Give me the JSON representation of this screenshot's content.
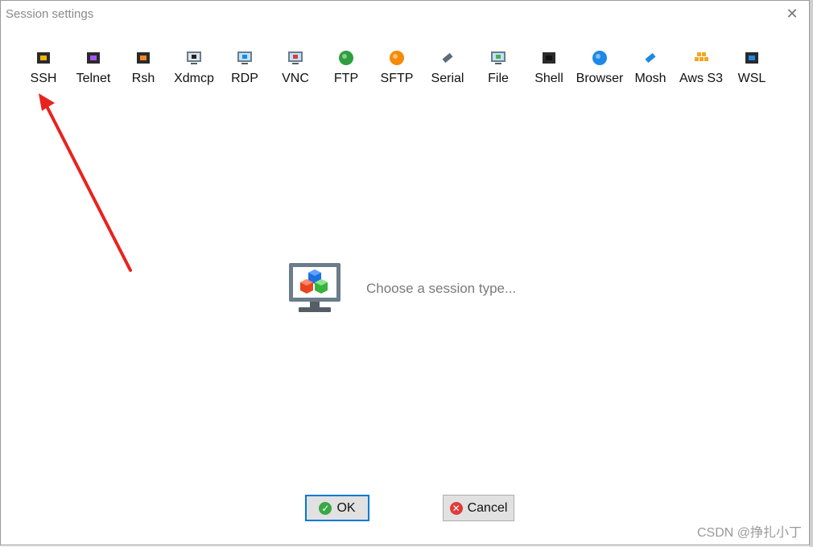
{
  "window": {
    "title": "Session settings",
    "close_glyph": "✕"
  },
  "toolbar": {
    "items": [
      {
        "label": "SSH",
        "icon": "ssh-key-icon",
        "color": "#f5b400"
      },
      {
        "label": "Telnet",
        "icon": "telnet-icon",
        "color": "#a855f7"
      },
      {
        "label": "Rsh",
        "icon": "rsh-icon",
        "color": "#f08a24"
      },
      {
        "label": "Xdmcp",
        "icon": "xdmcp-icon",
        "color": "#222222"
      },
      {
        "label": "RDP",
        "icon": "rdp-icon",
        "color": "#1e88e5"
      },
      {
        "label": "VNC",
        "icon": "vnc-icon",
        "color": "#e53935"
      },
      {
        "label": "FTP",
        "icon": "ftp-icon",
        "color": "#2e9e3e"
      },
      {
        "label": "SFTP",
        "icon": "sftp-icon",
        "color": "#f58a07"
      },
      {
        "label": "Serial",
        "icon": "serial-icon",
        "color": "#5c6b7a"
      },
      {
        "label": "File",
        "icon": "file-icon",
        "color": "#4caf50"
      },
      {
        "label": "Shell",
        "icon": "shell-icon",
        "color": "#111111"
      },
      {
        "label": "Browser",
        "icon": "browser-icon",
        "color": "#1e88e5"
      },
      {
        "label": "Mosh",
        "icon": "mosh-icon",
        "color": "#1e88e5"
      },
      {
        "label": "Aws S3",
        "icon": "aws-s3-icon",
        "color": "#f5a623"
      },
      {
        "label": "WSL",
        "icon": "wsl-icon",
        "color": "#1e88e5"
      }
    ]
  },
  "main": {
    "prompt": "Choose a session type..."
  },
  "buttons": {
    "ok": "OK",
    "cancel": "Cancel"
  },
  "annotation": {
    "arrow_color": "#e8231f"
  },
  "watermark": "CSDN @挣扎小丁"
}
